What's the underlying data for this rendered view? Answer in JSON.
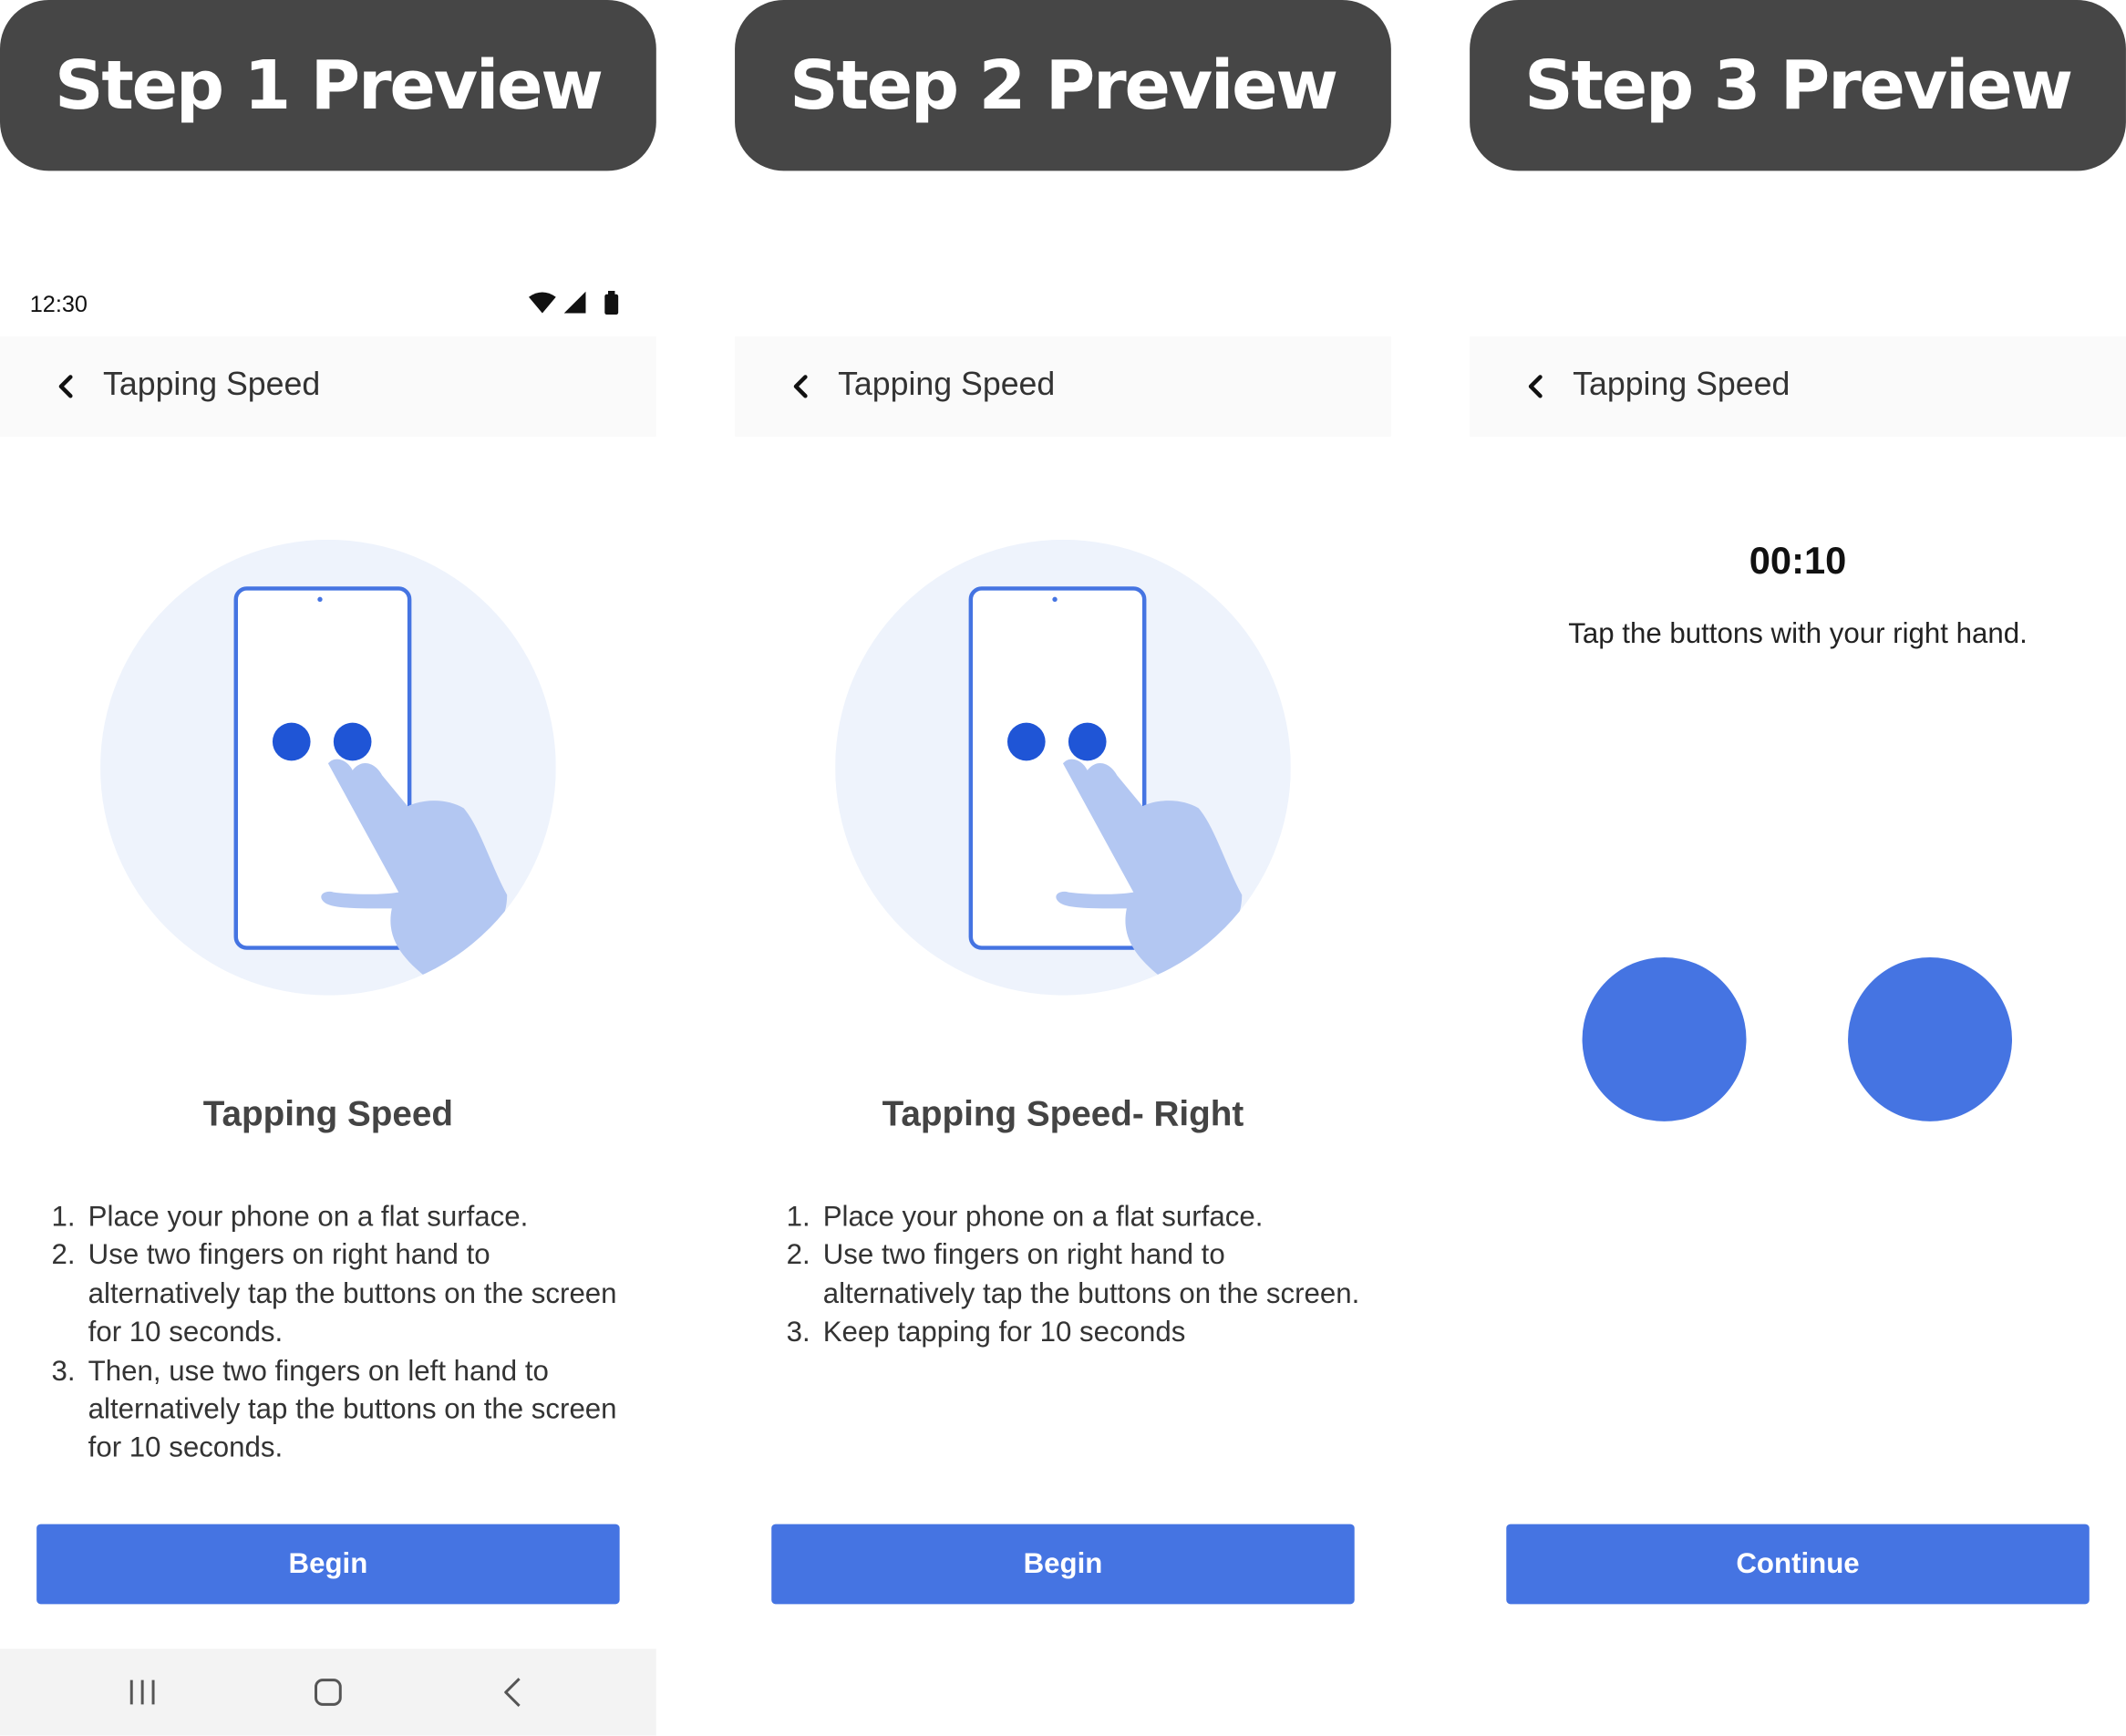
{
  "colors": {
    "header_bg": "#464646",
    "accent": "#4574e2",
    "dot_blue": "#1f55d6",
    "circle_bg": "#eef3fc",
    "hand": "#b3c7f2"
  },
  "panels": [
    {
      "header": "Step 1 Preview",
      "status": {
        "time": "12:30"
      },
      "appbar_title": "Tapping Speed",
      "title": "Tapping Speed",
      "steps": [
        {
          "num": "1.",
          "text": "Place your phone on a flat surface."
        },
        {
          "num": "2.",
          "text": "Use two fingers on right hand to alternatively tap the buttons on the screen for 10 seconds."
        },
        {
          "num": "3.",
          "text": "Then, use two fingers on left hand to alternatively tap the buttons on the screen for 10 seconds."
        }
      ],
      "button": "Begin"
    },
    {
      "header": "Step 2 Preview",
      "appbar_title": "Tapping Speed",
      "title": "Tapping Speed- Right",
      "steps": [
        {
          "num": "1.",
          "text": "Place your phone on a flat surface."
        },
        {
          "num": "2.",
          "text": "Use two fingers on right hand to alternatively tap the buttons on the screen."
        },
        {
          "num": "3.",
          "text": "Keep tapping for 10 seconds"
        }
      ],
      "button": "Begin"
    },
    {
      "header": "Step 3 Preview",
      "appbar_title": "Tapping Speed",
      "timer": "00:10",
      "instruction": "Tap the buttons with your right hand.",
      "button": "Continue"
    }
  ]
}
